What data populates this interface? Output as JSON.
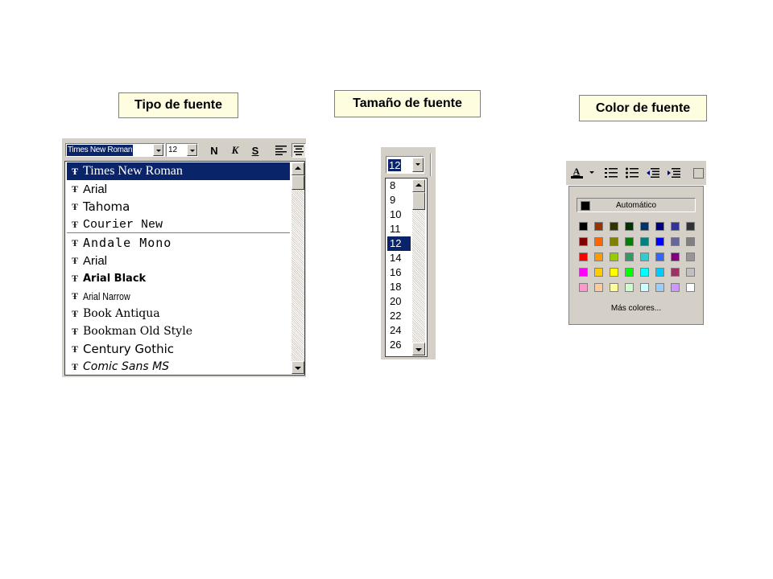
{
  "labels": {
    "font_type": "Tipo de fuente",
    "font_size": "Tamaño de fuente",
    "font_color": "Color de fuente"
  },
  "font_toolbar": {
    "font_name": "Times New Roman",
    "font_size": "12",
    "bold": "N",
    "italic": "K",
    "underline": "S"
  },
  "font_list": {
    "items": [
      {
        "name": "Times New Roman",
        "selected": true
      },
      {
        "name": "Arial"
      },
      {
        "name": "Tahoma"
      },
      {
        "name": "Courier New"
      },
      {
        "name": "Andale Mono"
      },
      {
        "name": "Arial"
      },
      {
        "name": "Arial Black"
      },
      {
        "name": "Arial Narrow"
      },
      {
        "name": "Book Antiqua"
      },
      {
        "name": "Bookman Old Style"
      },
      {
        "name": "Century Gothic"
      },
      {
        "name": "Comic Sans MS"
      }
    ]
  },
  "size_control": {
    "current": "12",
    "items": [
      "8",
      "9",
      "10",
      "11",
      "12",
      "14",
      "16",
      "18",
      "20",
      "22",
      "24",
      "26"
    ],
    "selected": "12"
  },
  "color_picker": {
    "automatic_label": "Automático",
    "more_colors_label": "Más colores...",
    "rows": [
      [
        "#000000",
        "#993300",
        "#333300",
        "#003300",
        "#003366",
        "#000080",
        "#333399",
        "#333333"
      ],
      [
        "#800000",
        "#ff6600",
        "#808000",
        "#008000",
        "#008080",
        "#0000ff",
        "#666699",
        "#808080"
      ],
      [
        "#ff0000",
        "#ff9900",
        "#99cc00",
        "#339966",
        "#33cccc",
        "#3366ff",
        "#800080",
        "#969696"
      ],
      [
        "#ff00ff",
        "#ffcc00",
        "#ffff00",
        "#00ff00",
        "#00ffff",
        "#00ccff",
        "#993366",
        "#c0c0c0"
      ],
      [
        "#ff99cc",
        "#ffcc99",
        "#ffff99",
        "#ccffcc",
        "#ccffff",
        "#99ccff",
        "#cc99ff",
        "#ffffff"
      ]
    ]
  },
  "colors": {
    "selection": "#0a246a",
    "window_face": "#d4d0c8",
    "label_background": "#fffde0"
  }
}
